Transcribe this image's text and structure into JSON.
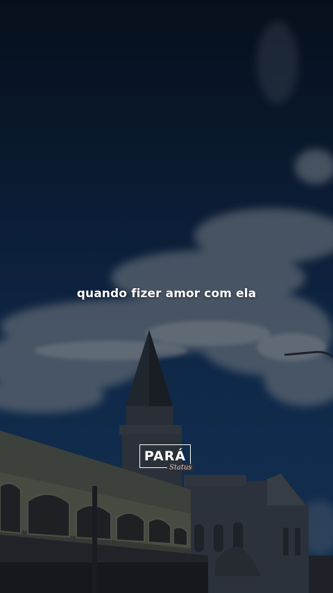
{
  "caption": "quando fizer amor com ela",
  "watermark": {
    "title": "PARÁ",
    "subtitle": "Status",
    "title_color": "#ffffff",
    "subtitle_color": "#e8c4c4"
  },
  "colors": {
    "sky_top": "#0c1a2e",
    "sky_mid": "#173a64",
    "cloud": "#8b97a6"
  }
}
